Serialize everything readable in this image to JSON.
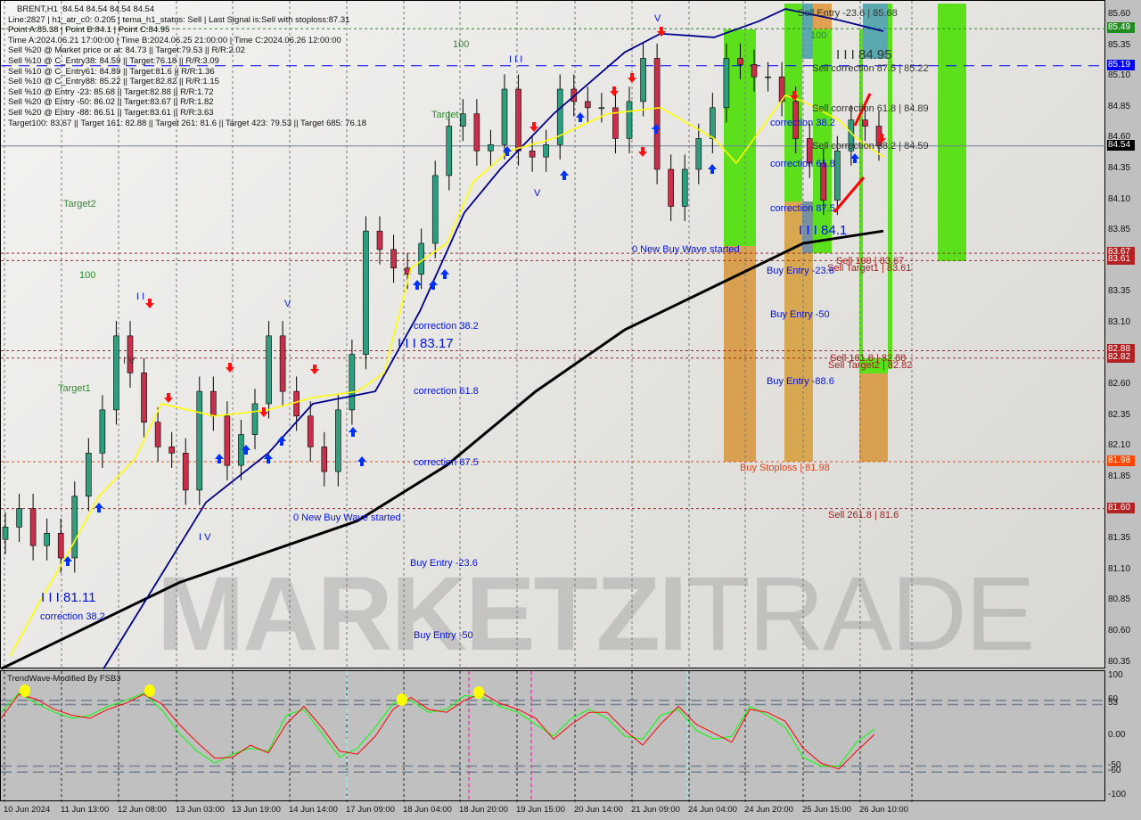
{
  "header": {
    "symbol_line": "BRENT,H1  84.54 84.54 84.54 84.54",
    "info_lines": [
      "Line:2827 | h1_atr_c0: 0.205 | tema_h1_status: Sell | Last Signal is:Sell with stoploss:87.31",
      "Point A:85.38 | Point B:84.1 | Point C:84.95",
      "Time A:2024.06.21 17:00:00 | Time B:2024.06.25 21:00:00 | Time C:2024.06.26 12:00:00",
      "Sell %20 @ Market price or at: 84.73 || Target:79.53 || R/R:2.02",
      "Sell %10 @ C_Entry38: 84.59 || Target:76.18 || R/R:3.09",
      "Sell %10 @ C_Entry61: 84.89 || Target:81.6 || R/R:1.36",
      "Sell %10 @ C_Entry88: 85.22 || Target:82.82 || R/R:1.15",
      "Sell %10 @ Entry -23: 85.68 || Target:82.88 || R/R:1.72",
      "Sell %20 @ Entry -50: 86.02 || Target:83.67 || R/R:1.82",
      "Sell %20 @ Entry -88: 86.51 || Target:83.61 || R/R:3.63",
      "Target100: 83.67 || Target 161: 82.88 || Target 261: 81.6 || Target 423: 79.53 || Target 685: 76.18"
    ]
  },
  "watermark": {
    "bold": "MARKETZI",
    "light": "TRADE"
  },
  "labels": {
    "target1": "Target1",
    "target2": "Target2",
    "l100a": "100",
    "target_b": "Target",
    "l100b": "100",
    "l100c": "100",
    "w8111": "I I I 81.11",
    "c382a": "correction 38.2",
    "iv1": "I V",
    "iv2": "I V",
    "ii": "I I",
    "v1": "V",
    "v2": "V",
    "v3": "V",
    "iii": "I I I",
    "c382b": "correction 38.2",
    "w8317": "I I I 83.17",
    "c618b": "correction 61.8",
    "c875b": "correction 87.5",
    "nbw1": "0 New Buy Wave started",
    "be236a": "Buy Entry -23.6",
    "be50a": "Buy Entry -50",
    "nbw2": "0 New Buy Wave started",
    "se236": "Sell Entry -23.6 | 85.68",
    "w8495": "I I I 84.95",
    "sc875": "Sell correction 87.5 | 85.22",
    "sc618": "Sell correction 61.8 | 84.89",
    "c382c": "correction 38.2",
    "sc382": "Sell correction 38.2 | 84.59",
    "c618c": "correction 61.8",
    "c875c": "correction 87.5",
    "w841": "I I I 84.1",
    "s100": "Sell 100 | 83.67",
    "st1": "Sell Target1 | 83.61",
    "be236b": "Buy Entry -23.6",
    "be50b": "Buy Entry -50",
    "s1618": "Sell 161.8 | 82.88",
    "st2": "Sell Target2 | 82.82",
    "be886": "Buy Entry -88.6",
    "bsl": "Buy Stoploss | 81.98",
    "s2618": "Sell 261.8 | 81.6"
  },
  "price_tags": [
    {
      "value": "85.49",
      "color": "#228b22"
    },
    {
      "value": "85.19",
      "color": "#0000ff"
    },
    {
      "value": "84.54",
      "color": "#000000"
    },
    {
      "value": "83.67",
      "color": "#b22222"
    },
    {
      "value": "83.61",
      "color": "#b22222"
    },
    {
      "value": "82.88",
      "color": "#b22222"
    },
    {
      "value": "82.82",
      "color": "#b22222"
    },
    {
      "value": "81.98",
      "color": "#ff4500"
    },
    {
      "value": "81.60",
      "color": "#b22222"
    }
  ],
  "indicator": {
    "title": "TrendWave-Modified By FSB3",
    "axis": [
      "100",
      "60",
      "53",
      "0.00",
      "-50",
      "-60",
      "-100"
    ]
  },
  "chart_data": [
    {
      "type": "candlestick",
      "symbol": "BRENT",
      "timeframe": "H1",
      "ylim": [
        80.3,
        85.68
      ],
      "y_ticks": [
        "85.60",
        "85.35",
        "85.10",
        "84.85",
        "84.60",
        "84.35",
        "84.10",
        "83.85",
        "83.60",
        "83.35",
        "83.10",
        "82.85",
        "82.60",
        "82.35",
        "82.10",
        "81.85",
        "81.60",
        "81.35",
        "81.10",
        "80.85",
        "80.60",
        "80.35"
      ],
      "x_ticks": [
        "10 Jun 2024",
        "11 Jun 13:00",
        "12 Jun 08:00",
        "13 Jun 03:00",
        "13 Jun 19:00",
        "14 Jun 14:00",
        "17 Jun 09:00",
        "18 Jun 04:00",
        "18 Jun 20:00",
        "19 Jun 15:00",
        "20 Jun 14:00",
        "21 Jun 09:00",
        "24 Jun 04:00",
        "24 Jun 20:00",
        "25 Jun 15:00",
        "26 Jun 10:00"
      ],
      "close_samples": [
        81.45,
        81.6,
        81.3,
        81.4,
        81.2,
        81.7,
        82.05,
        82.4,
        83.0,
        82.7,
        82.3,
        82.1,
        82.05,
        81.75,
        82.55,
        82.35,
        81.95,
        82.2,
        82.45,
        83.0,
        82.55,
        82.35,
        82.1,
        81.9,
        82.4,
        82.85,
        83.85,
        83.7,
        83.55,
        83.5,
        83.75,
        84.3,
        84.7,
        84.8,
        84.5,
        84.55,
        85.0,
        84.5,
        84.45,
        84.55,
        85.0,
        84.9,
        84.85,
        84.85,
        84.6,
        84.9,
        85.25,
        84.35,
        84.05,
        84.35,
        84.6,
        84.85,
        85.25,
        85.2,
        85.1,
        85.1,
        84.9,
        84.6,
        84.4,
        84.1,
        84.5,
        84.75,
        84.7,
        84.54
      ],
      "series": [
        {
          "color": "#000000",
          "values": [
            80.3,
            81.0,
            81.5,
            81.95,
            82.55,
            83.05,
            83.4,
            83.75,
            83.85
          ]
        },
        {
          "color": "#00008b",
          "values": [
            80.3,
            81.65,
            82.05,
            82.45,
            82.55,
            83.2,
            84.0,
            84.35,
            84.8,
            85.3,
            85.45,
            85.42,
            85.55,
            85.65,
            85.56,
            85.47
          ]
        },
        {
          "color": "#ffff00",
          "values": [
            80.4,
            80.8,
            81.3,
            81.7,
            82.0,
            82.45,
            82.35,
            82.4,
            82.5,
            82.55,
            82.7,
            83.55,
            83.75,
            84.25,
            84.5,
            84.6,
            84.8,
            84.85,
            84.6,
            84.4,
            84.75,
            84.95,
            84.9,
            84.75,
            84.6,
            84.45
          ]
        }
      ],
      "levels": [
        {
          "value": 85.49,
          "color": "#228b22",
          "style": "dotted"
        },
        {
          "value": 85.19,
          "color": "#0000ff",
          "style": "dashed"
        },
        {
          "value": 84.54,
          "color": "#708090",
          "style": "solid"
        },
        {
          "value": 83.67,
          "color": "#b22222",
          "style": "dotted"
        },
        {
          "value": 83.61,
          "color": "#b22222",
          "style": "dotted"
        },
        {
          "value": 82.88,
          "color": "#b22222",
          "style": "dotted"
        },
        {
          "value": 82.82,
          "color": "#b22222",
          "style": "dotted"
        },
        {
          "value": 81.98,
          "color": "#ff4500",
          "style": "dotted"
        },
        {
          "value": 81.6,
          "color": "#b22222",
          "style": "dotted"
        }
      ]
    },
    {
      "type": "line",
      "title": "TrendWave-Modified By FSB3",
      "ylim": [
        -100,
        100
      ],
      "levels": [
        60,
        53,
        -50,
        -60
      ],
      "series": [
        {
          "color": "#ff0000",
          "values": [
            30,
            70,
            62,
            45,
            35,
            30,
            45,
            55,
            70,
            55,
            20,
            -10,
            -37,
            -35,
            -15,
            -28,
            20,
            50,
            15,
            -25,
            -30,
            0,
            45,
            65,
            45,
            40,
            60,
            72,
            55,
            45,
            30,
            -5,
            20,
            40,
            40,
            10,
            -15,
            20,
            50,
            20,
            5,
            -10,
            45,
            40,
            25,
            -20,
            -45,
            -55,
            -25,
            3
          ]
        },
        {
          "color": "#00ff00",
          "values": [
            40,
            72,
            55,
            40,
            30,
            35,
            50,
            60,
            72,
            45,
            5,
            -25,
            -45,
            -30,
            -20,
            -25,
            35,
            45,
            5,
            -35,
            -20,
            15,
            55,
            60,
            40,
            45,
            68,
            65,
            50,
            40,
            20,
            0,
            30,
            45,
            30,
            0,
            -5,
            35,
            45,
            10,
            -5,
            0,
            50,
            35,
            15,
            -35,
            -50,
            -50,
            -10,
            12
          ]
        }
      ]
    }
  ]
}
